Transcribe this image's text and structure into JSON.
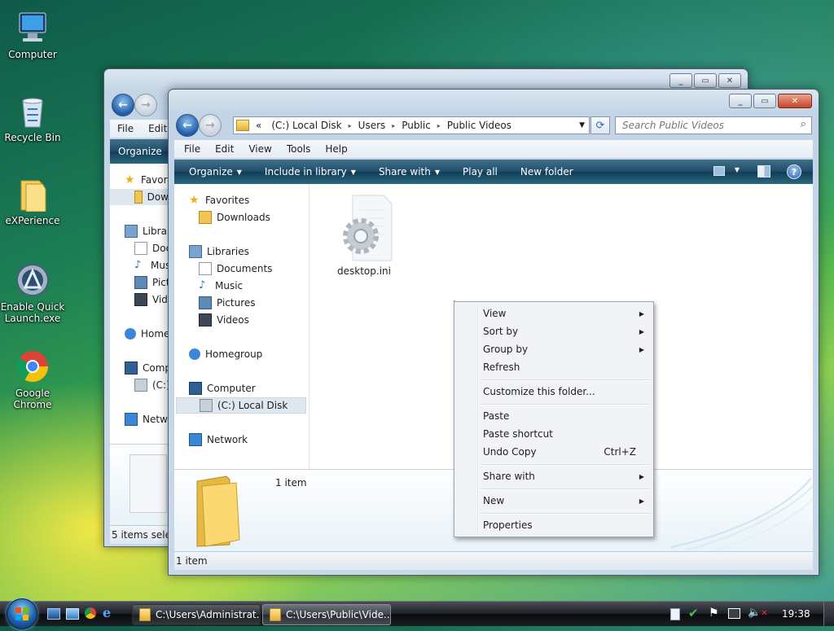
{
  "desktop": {
    "icons": [
      {
        "label": "Computer",
        "icon": "computer-icon"
      },
      {
        "label": "Recycle Bin",
        "icon": "recycle-bin-icon"
      },
      {
        "label": "eXPerience",
        "icon": "folder-icon"
      },
      {
        "label": "Enable Quick Launch.exe",
        "icon": "quick-launch-icon"
      },
      {
        "label": "Google Chrome",
        "icon": "chrome-icon"
      }
    ]
  },
  "back_window": {
    "menu": [
      "File",
      "Edit"
    ],
    "command": "Organize",
    "nav": [
      "Favori",
      "Dow",
      "Librar",
      "Doc",
      "Musi",
      "Pict",
      "Vide",
      "Home",
      "Comp",
      "(C:)",
      "Netw"
    ],
    "status": "5 items select"
  },
  "front_window": {
    "address": {
      "overflow": "«",
      "crumbs": [
        "(C:) Local Disk",
        "Users",
        "Public",
        "Public Videos"
      ]
    },
    "search_placeholder": "Search Public Videos",
    "menu": [
      "File",
      "Edit",
      "View",
      "Tools",
      "Help"
    ],
    "commands": {
      "organize": "Organize",
      "include": "Include in library",
      "share": "Share with",
      "play": "Play all",
      "new_folder": "New folder"
    },
    "nav": {
      "favorites": "Favorites",
      "downloads": "Downloads",
      "libraries": "Libraries",
      "documents": "Documents",
      "music": "Music",
      "pictures": "Pictures",
      "videos": "Videos",
      "homegroup": "Homegroup",
      "computer": "Computer",
      "local_disk": "(C:) Local Disk",
      "network": "Network"
    },
    "file": {
      "name": "desktop.ini",
      "icon": "settings-file-icon"
    },
    "details_count": "1 item",
    "status": "1 item"
  },
  "context_menu": {
    "items": [
      {
        "label": "View",
        "submenu": true
      },
      {
        "label": "Sort by",
        "submenu": true
      },
      {
        "label": "Group by",
        "submenu": true
      },
      {
        "label": "Refresh"
      },
      {
        "label": "Customize this folder..."
      },
      {
        "label": "Paste"
      },
      {
        "label": "Paste shortcut"
      },
      {
        "label": "Undo Copy",
        "shortcut": "Ctrl+Z"
      },
      {
        "label": "Share with",
        "submenu": true
      },
      {
        "label": "New",
        "submenu": true
      },
      {
        "label": "Properties"
      }
    ]
  },
  "taskbar": {
    "buttons": [
      "C:\\Users\\Administrat...",
      "C:\\Users\\Public\\Vide..."
    ],
    "clock": "19:38"
  },
  "colors": {
    "command_bar": "#1f4d69",
    "selection": "#dfe7ef",
    "close_button": "#c7432a"
  }
}
